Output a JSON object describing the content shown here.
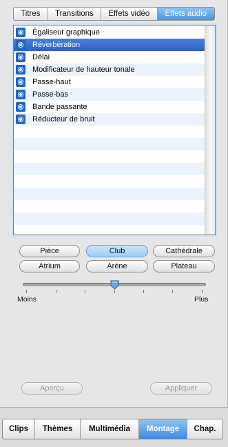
{
  "top_tabs": [
    {
      "label": "Titres"
    },
    {
      "label": "Transitions"
    },
    {
      "label": "Effets vidéo"
    },
    {
      "label": "Effets audio"
    }
  ],
  "effects": [
    {
      "label": "Égaliseur graphique",
      "icon": "audio-effect-icon"
    },
    {
      "label": "Réverbération",
      "icon": "audio-effect-icon"
    },
    {
      "label": "Délai",
      "icon": "audio-effect-icon"
    },
    {
      "label": "Modificateur de hauteur tonale",
      "icon": "audio-effect-icon"
    },
    {
      "label": "Passe-haut",
      "icon": "audio-effect-icon"
    },
    {
      "label": "Passe-bas",
      "icon": "audio-effect-icon"
    },
    {
      "label": "Bande passante",
      "icon": "audio-effect-icon"
    },
    {
      "label": "Réducteur de bruit",
      "icon": "audio-effect-icon"
    }
  ],
  "presets": [
    {
      "label": "Pièce"
    },
    {
      "label": "Club"
    },
    {
      "label": "Cathédrale"
    },
    {
      "label": "Atrium"
    },
    {
      "label": "Arène"
    },
    {
      "label": "Plateau"
    }
  ],
  "slider": {
    "min_label": "Moins",
    "max_label": "Plus",
    "level": 0.5
  },
  "actions": {
    "preview": "Aperçu",
    "apply": "Appliquer"
  },
  "bottom_tabs": [
    {
      "label": "Clips"
    },
    {
      "label": "Thèmes"
    },
    {
      "label": "Multimédia"
    },
    {
      "label": "Montage"
    },
    {
      "label": "Chap."
    }
  ],
  "colors": {
    "accent": "#3f8be0",
    "selection": "#3768cd"
  }
}
